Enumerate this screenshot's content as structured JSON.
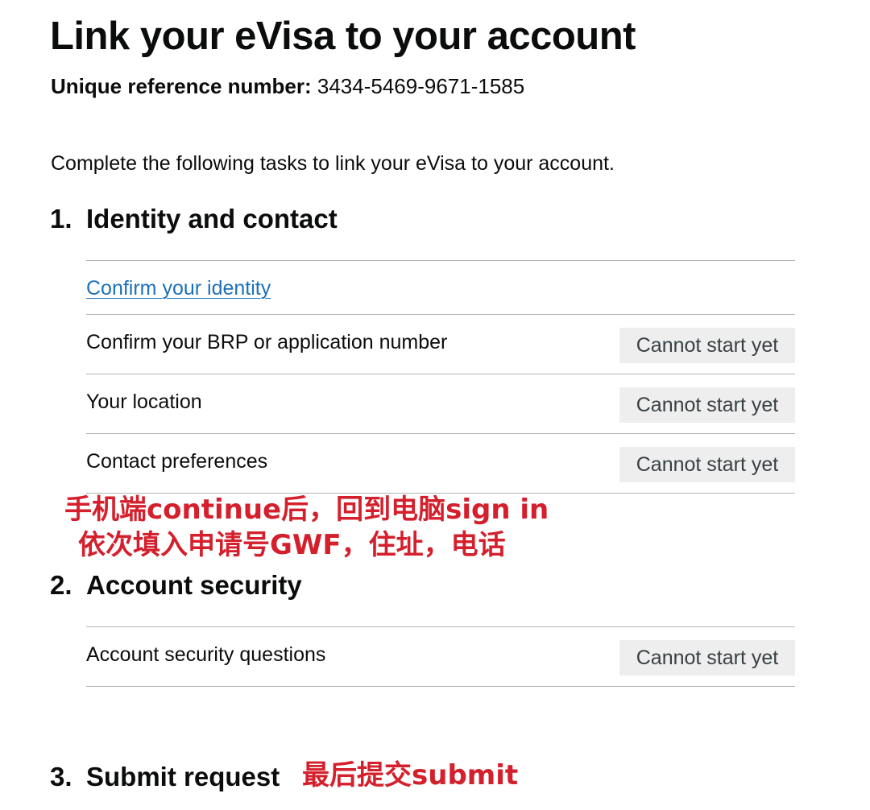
{
  "page": {
    "title": "Link your eVisa to your account",
    "reference_label": "Unique reference number:",
    "reference_value": "3434-5469-9671-1585",
    "intro": "Complete the following tasks to link your eVisa to your account."
  },
  "sections": [
    {
      "number": "1.",
      "heading": "Identity and contact",
      "tasks": [
        {
          "name": "Confirm your identity",
          "status": ""
        },
        {
          "name": "Confirm your BRP or application number",
          "status": "Cannot start yet"
        },
        {
          "name": "Your location",
          "status": "Cannot start yet"
        },
        {
          "name": "Contact preferences",
          "status": "Cannot start yet"
        }
      ]
    },
    {
      "number": "2.",
      "heading": "Account security",
      "tasks": [
        {
          "name": "Account security questions",
          "status": "Cannot start yet"
        }
      ]
    },
    {
      "number": "3.",
      "heading": "Submit request",
      "tasks": []
    }
  ],
  "annotations": {
    "line1": "手机端continue后，回到电脑sign in",
    "line2": "依次填入申请号GWF，住址，电话",
    "submit_note": "最后提交submit"
  },
  "colors": {
    "text": "#0b0c0c",
    "link": "#1d70b8",
    "tag_background": "#eeeeee",
    "tag_text": "#383f43",
    "annotation": "#d4202c",
    "divider": "#b1b4b6"
  }
}
